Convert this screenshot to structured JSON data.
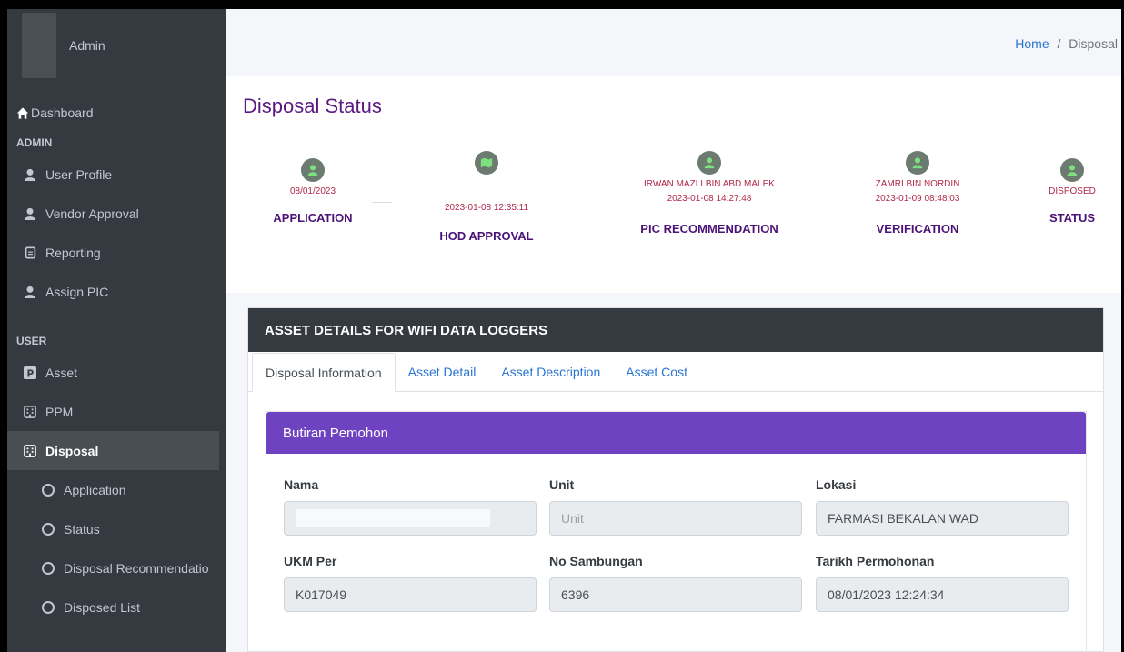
{
  "sidebar": {
    "user_name": "Admin",
    "dashboard": "Dashboard",
    "admin_header": "ADMIN",
    "admin_items": [
      "User Profile",
      "Vendor Approval",
      "Reporting",
      "Assign PIC"
    ],
    "user_header": "USER",
    "user_items": [
      "Asset",
      "PPM",
      "Disposal"
    ],
    "disposal_sub": [
      "Application",
      "Status",
      "Disposal Recommendatio",
      "Disposed List"
    ]
  },
  "breadcrumb": {
    "home": "Home",
    "sep": "/",
    "current": "Disposal"
  },
  "status": {
    "title": "Disposal Status",
    "steps": [
      {
        "name": "",
        "date": "08/01/2023",
        "label": "APPLICATION"
      },
      {
        "name": "",
        "date": "2023-01-08 12:35:11",
        "label": "HOD APPROVAL"
      },
      {
        "name": "IRWAN MAZLI BIN ABD MALEK",
        "date": "2023-01-08 14:27:48",
        "label": "PIC RECOMMENDATION"
      },
      {
        "name": "ZAMRI BIN NORDIN",
        "date": "2023-01-09 08:48:03",
        "label": "VERIFICATION"
      },
      {
        "name": "",
        "date": "DISPOSED",
        "label": "STATUS"
      }
    ]
  },
  "card": {
    "title": "ASSET DETAILS FOR WIFI DATA LOGGERS",
    "tabs": [
      "Disposal Information",
      "Asset Detail",
      "Asset Description",
      "Asset Cost"
    ],
    "section_title": "Butiran Pemohon",
    "fields": {
      "nama": {
        "label": "Nama",
        "value": ""
      },
      "unit": {
        "label": "Unit",
        "placeholder": "Unit"
      },
      "lokasi": {
        "label": "Lokasi",
        "value": "FARMASI BEKALAN WAD"
      },
      "ukm_per": {
        "label": "UKM Per",
        "value": "K017049"
      },
      "no_sambungan": {
        "label": "No Sambungan",
        "value": "6396"
      },
      "tarikh": {
        "label": "Tarikh Permohonan",
        "value": "08/01/2023 12:24:34"
      }
    }
  },
  "colors": {
    "accent": "#6f42c1",
    "title": "#5a1a82",
    "sidebar": "#343a40"
  }
}
